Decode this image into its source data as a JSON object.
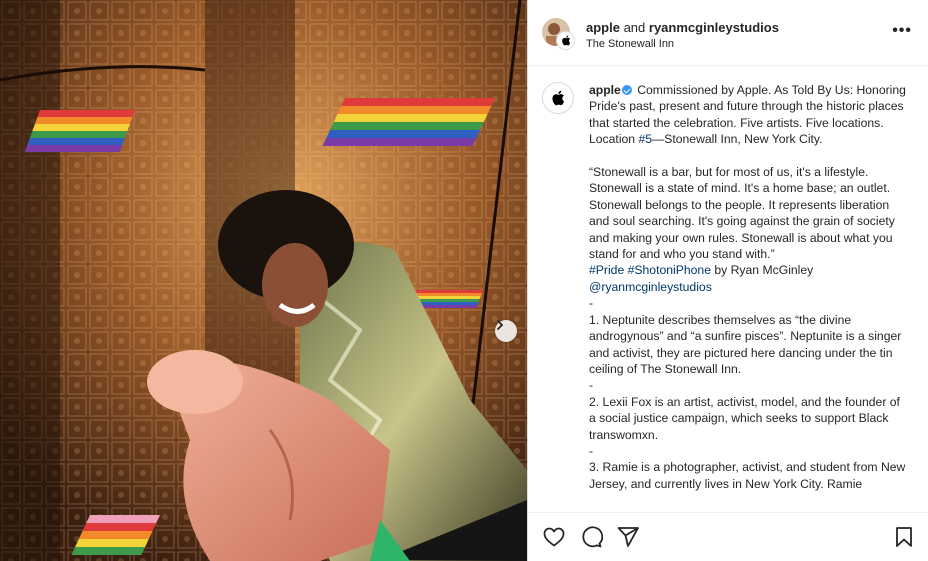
{
  "header": {
    "author_primary": "apple",
    "and_text": " and ",
    "author_secondary": "ryanmcginleystudios",
    "location": "The Stonewall Inn",
    "more_label": "•••"
  },
  "caption": {
    "username": "apple",
    "intro": " Commissioned by Apple. As Told By Us: Honoring Pride's past, present and future through the historic places that started the celebration. Five artists. Five locations. Location ",
    "location_tag": "#5",
    "intro_end": "—Stonewall Inn, New York City.",
    "quote": "“Stonewall is a bar, but for most of us, it's a lifestyle. Stonewall is a state of mind. It's a home base; an outlet. Stonewall belongs to the people. It represents liberation and soul searching. It's going against the grain of society and making your own rules. Stonewall is about what you stand for and who you stand with.”",
    "hashtag1": "#Pride",
    "hashtag2": "#ShotoniPhone",
    "by_text": " by Ryan McGinley",
    "mention": "@ryanmcginleystudios",
    "dash": "-",
    "item1": "1. Neptunite describes themselves as “the divine androgynous” and “a sunfire pisces”. Neptunite is a singer and activist, they are pictured here dancing under the tin ceiling of The Stonewall Inn.",
    "item2": "2. Lexii Fox is an artist, activist, model, and the founder of a social justice campaign, which seeks to support Black transwomxn.",
    "item3": "3. Ramie is a photographer, activist, and student from New Jersey, and currently lives in New York City. Ramie"
  },
  "icons": {
    "like": "heart-icon",
    "comment": "comment-icon",
    "share": "send-icon",
    "save": "bookmark-icon",
    "next": "chevron-right-icon",
    "apple": "apple-logo-icon"
  },
  "colors": {
    "link": "#00376b",
    "verified": "#3897f0"
  }
}
